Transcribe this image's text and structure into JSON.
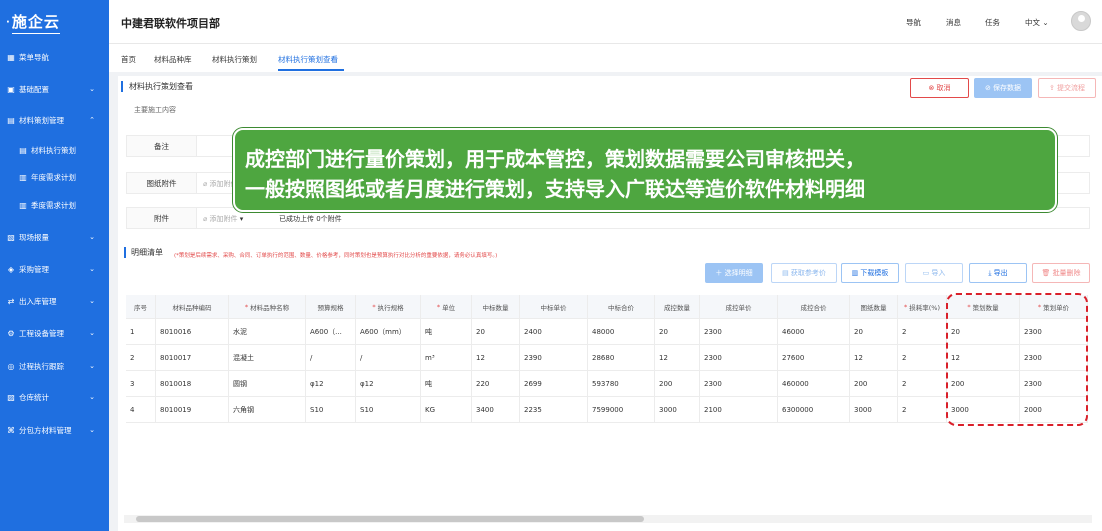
{
  "sidebar": {
    "logo": "施企云",
    "items": [
      {
        "icon": "grid-icon",
        "label": "菜单导航",
        "chevron": false
      },
      {
        "icon": "apps-icon",
        "label": "基础配置",
        "chevron": true
      },
      {
        "icon": "doc-icon",
        "label": "材料策划管理",
        "chevron": true
      },
      {
        "icon": "doc-icon",
        "label": "材料执行策划",
        "chevron": false
      },
      {
        "icon": "calendar-icon",
        "label": "年度需求计划",
        "chevron": false
      },
      {
        "icon": "calendar-icon",
        "label": "季度需求计划",
        "chevron": false
      },
      {
        "icon": "box-icon",
        "label": "现场报量",
        "chevron": true
      },
      {
        "icon": "cart-icon",
        "label": "采购管理",
        "chevron": true
      },
      {
        "icon": "swap-icon",
        "label": "出入库管理",
        "chevron": true
      },
      {
        "icon": "gear-icon",
        "label": "工程设备管理",
        "chevron": true
      },
      {
        "icon": "track-icon",
        "label": "过程执行跟踪",
        "chevron": true
      },
      {
        "icon": "warehouse-icon",
        "label": "仓库统计",
        "chevron": true
      },
      {
        "icon": "link-icon",
        "label": "分包方材料管理",
        "chevron": true
      }
    ]
  },
  "header": {
    "project_title": "中建君联软件项目部",
    "links": [
      "导航",
      "消息",
      "任务",
      "中文"
    ]
  },
  "tabs": [
    "首页",
    "材料品种库",
    "材料执行策划",
    "材料执行策划查看"
  ],
  "page": {
    "title": "材料执行策划查看",
    "cancel": "取消",
    "save": "保存数据",
    "submit": "提交流程",
    "clipped_label": "主要施工内容",
    "remark_label": "备注",
    "drawing_label": "图纸附件",
    "drawing_value": "添加附件",
    "attach_label": "附件",
    "attach_add": "添加附件",
    "attach_status": "已成功上传 0个附件"
  },
  "detail": {
    "title": "明细清单",
    "note": "(*策划是后续需求、采购、合同、订单执行的范围、数量、价格参考，同时策划也是预算执行对比分析的重要依据，请务必认真填写。)",
    "tools": [
      "选择明细",
      "获取参考价",
      "下载模板",
      "导入",
      "导出",
      "批量删除"
    ]
  },
  "table": {
    "columns": [
      {
        "label": "序号",
        "req": false
      },
      {
        "label": "材料品种编码",
        "req": false
      },
      {
        "label": "材料品种名称",
        "req": true
      },
      {
        "label": "预算规格",
        "req": false
      },
      {
        "label": "执行规格",
        "req": true
      },
      {
        "label": "单位",
        "req": true
      },
      {
        "label": "中标数量",
        "req": false
      },
      {
        "label": "中标单价",
        "req": false
      },
      {
        "label": "中标合价",
        "req": false
      },
      {
        "label": "成控数量",
        "req": false
      },
      {
        "label": "成控单价",
        "req": false
      },
      {
        "label": "成控合价",
        "req": false
      },
      {
        "label": "图纸数量",
        "req": false
      },
      {
        "label": "损耗率(%)",
        "req": true
      },
      {
        "label": "策划数量",
        "req": true
      },
      {
        "label": "策划单价",
        "req": true
      }
    ],
    "rows": [
      [
        "1",
        "8010016",
        "水泥",
        "A600（...",
        "A600（mm）",
        "吨",
        "20",
        "2400",
        "48000",
        "20",
        "2300",
        "46000",
        "20",
        "2",
        "20",
        "2300"
      ],
      [
        "2",
        "8010017",
        "混凝土",
        "/",
        "/",
        "m³",
        "12",
        "2390",
        "28680",
        "12",
        "2300",
        "27600",
        "12",
        "2",
        "12",
        "2300"
      ],
      [
        "3",
        "8010018",
        "圆钢",
        "φ12",
        "φ12",
        "吨",
        "220",
        "2699",
        "593780",
        "200",
        "2300",
        "460000",
        "200",
        "2",
        "200",
        "2300"
      ],
      [
        "4",
        "8010019",
        "六角钢",
        "S10",
        "S10",
        "KG",
        "3400",
        "2235",
        "7599000",
        "3000",
        "2100",
        "6300000",
        "3000",
        "2",
        "3000",
        "2000"
      ]
    ]
  },
  "callout": {
    "line1": "成控部门进行量价策划，用于成本管控，策划数据需要公司审核把关，",
    "line2": "一般按照图纸或者月度进行策划，支持导入广联达等造价软件材料明细"
  },
  "colors": {
    "brand": "#1f6fe0",
    "callout": "#4ea640",
    "danger": "#e24a4a"
  }
}
